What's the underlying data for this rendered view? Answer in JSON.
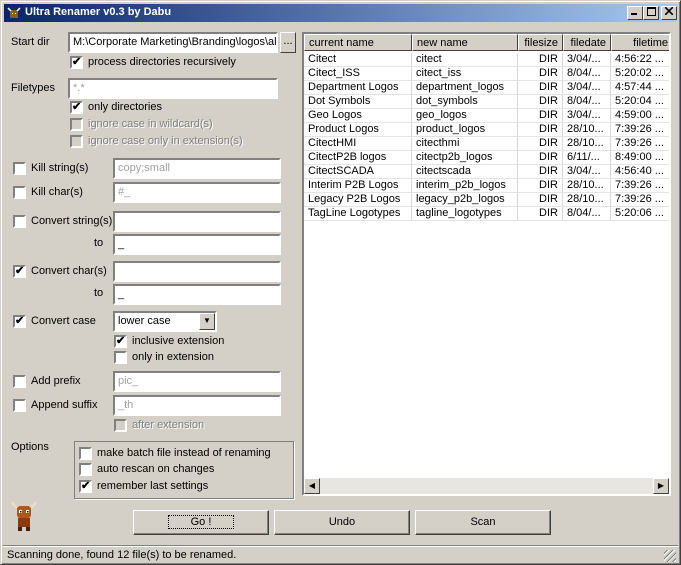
{
  "window": {
    "title": "Ultra Renamer v0.3 by Dabu"
  },
  "start_dir": {
    "label": "Start dir",
    "value": "M:\\Corporate Marketing\\Branding\\logos\\al",
    "browse": "..."
  },
  "process_recursive": {
    "label": "process directories recursively",
    "checked": true
  },
  "filetypes": {
    "label": "Filetypes",
    "value": "*.*",
    "only_dirs": "only directories",
    "ignore_wildcard": "ignore case in wildcard(s)",
    "ignore_extension": "ignore case only in extension(s)"
  },
  "kill_string": {
    "label": "Kill string(s)",
    "value": "copy;small"
  },
  "kill_char": {
    "label": "Kill char(s)",
    "value": "#_"
  },
  "convert_string": {
    "label": "Convert string(s)",
    "value": "",
    "to_label": "to",
    "to_value": "_"
  },
  "convert_char": {
    "label": "Convert char(s)",
    "value": "",
    "to_label": "to",
    "to_value": "_"
  },
  "convert_case": {
    "label": "Convert case",
    "selected": "lower case",
    "inclusive_extension": "inclusive extension",
    "only_extension": "only in extension"
  },
  "add_prefix": {
    "label": "Add prefix",
    "value": "pic_"
  },
  "append_suffix": {
    "label": "Append suffix",
    "value": "_th",
    "after_extension": "after extension"
  },
  "options": {
    "label": "Options",
    "batch": "make batch file instead of renaming",
    "rescan": "auto rescan on changes",
    "remember": "remember last settings"
  },
  "buttons": {
    "go": "Go !",
    "undo": "Undo",
    "scan": "Scan"
  },
  "list": {
    "columns": [
      "current name",
      "new name",
      "filesize",
      "filedate",
      "filetime"
    ],
    "rows": [
      [
        "Citect",
        "citect",
        "DIR",
        "3/04/...",
        "4:56:22 ..."
      ],
      [
        "Citect_ISS",
        "citect_iss",
        "DIR",
        "8/04/...",
        "5:20:02 ..."
      ],
      [
        "Department Logos",
        "department_logos",
        "DIR",
        "3/04/...",
        "4:57:44 ..."
      ],
      [
        "Dot Symbols",
        "dot_symbols",
        "DIR",
        "8/04/...",
        "5:20:04 ..."
      ],
      [
        "Geo Logos",
        "geo_logos",
        "DIR",
        "3/04/...",
        "4:59:00 ..."
      ],
      [
        "Product Logos",
        "product_logos",
        "DIR",
        "28/10...",
        "7:39:26 ..."
      ],
      [
        "CitectHMI",
        "citecthmi",
        "DIR",
        "28/10...",
        "7:39:26 ..."
      ],
      [
        "CitectP2B logos",
        "citectp2b_logos",
        "DIR",
        "6/11/...",
        "8:49:00 ..."
      ],
      [
        "CitectSCADA",
        "citectscada",
        "DIR",
        "3/04/...",
        "4:56:40 ..."
      ],
      [
        "Interim P2B Logos",
        "interim_p2b_logos",
        "DIR",
        "28/10...",
        "7:39:26 ..."
      ],
      [
        "Legacy P2B Logos",
        "legacy_p2b_logos",
        "DIR",
        "28/10...",
        "7:39:26 ..."
      ],
      [
        "TagLine Logotypes",
        "tagline_logotypes",
        "DIR",
        "8/04/...",
        "5:20:06 ..."
      ]
    ]
  },
  "status": "Scanning done, found 12 file(s) to be renamed.",
  "check": "✔",
  "icons": {
    "app": "bull-icon",
    "min": "minimize-icon",
    "max": "maximize-icon",
    "close": "close-icon"
  }
}
